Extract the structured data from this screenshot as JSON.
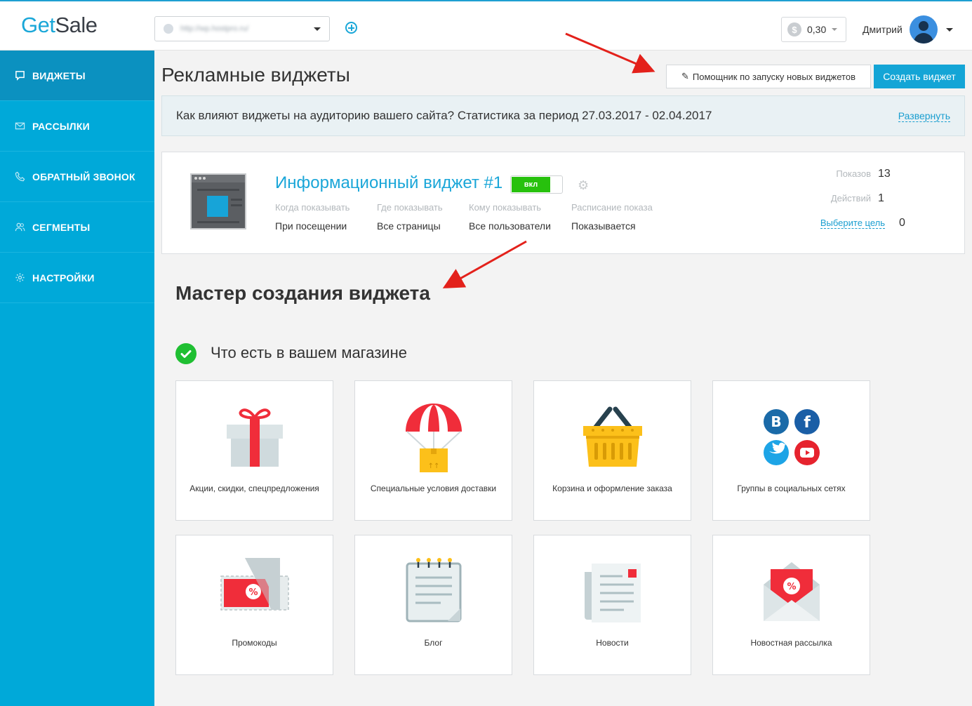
{
  "header": {
    "logo_part1": "Get",
    "logo_part2": "Sale",
    "site_url": "http://wp.hostpro.ru/",
    "balance": "0,30",
    "balance_icon": "dollar-coin-icon",
    "username": "Дмитрий"
  },
  "sidebar": {
    "items": [
      {
        "label": "ВИДЖЕТЫ",
        "icon": "chat-bubble-icon",
        "active": true
      },
      {
        "label": "РАССЫЛКИ",
        "icon": "envelope-icon",
        "active": false
      },
      {
        "label": "ОБРАТНЫЙ ЗВОНОК",
        "icon": "phone-icon",
        "active": false
      },
      {
        "label": "СЕГМЕНТЫ",
        "icon": "users-icon",
        "active": false
      },
      {
        "label": "НАСТРОЙКИ",
        "icon": "gear-icon",
        "active": false
      }
    ]
  },
  "main": {
    "title": "Рекламные виджеты",
    "helper_button": "Помощник по запуску новых виджетов",
    "create_button": "Создать виджет",
    "stats_text": "Как влияют виджеты на аудиторию вашего сайта? Статистика за период 27.03.2017 - 02.04.2017",
    "stats_expand": "Развернуть"
  },
  "widget": {
    "name": "Информационный виджет #1",
    "toggle_label": "вкл",
    "meta": [
      {
        "key": "Когда показывать",
        "value": "При посещении"
      },
      {
        "key": "Где показывать",
        "value": "Все страницы"
      },
      {
        "key": "Кому показывать",
        "value": "Все пользователи"
      },
      {
        "key": "Расписание показа",
        "value": "Показывается"
      }
    ],
    "stats": [
      {
        "key": "Показов",
        "value": "13"
      },
      {
        "key": "Действий",
        "value": "1"
      },
      {
        "key": "Выберите цель",
        "value": "0"
      }
    ]
  },
  "wizard": {
    "title": "Мастер создания виджета",
    "step_title": "Что есть в вашем магазине",
    "tiles": [
      {
        "label": "Акции, скидки, спецпредложения",
        "icon": "gift-icon"
      },
      {
        "label": "Специальные условия доставки",
        "icon": "parachute-box-icon"
      },
      {
        "label": "Корзина и оформление заказа",
        "icon": "basket-icon"
      },
      {
        "label": "Группы в социальных сетях",
        "icon": "social-networks-icon"
      },
      {
        "label": "Промокоды",
        "icon": "coupon-icon"
      },
      {
        "label": "Блог",
        "icon": "notepad-icon"
      },
      {
        "label": "Новости",
        "icon": "newspaper-icon"
      },
      {
        "label": "Новостная рассылка",
        "icon": "mail-envelope-icon"
      }
    ]
  },
  "colors": {
    "brand": "#1aa7d8",
    "sidebar": "#00a9d9",
    "sidebar_active": "#0b91c0",
    "toggle_on": "#27c10d",
    "annotation_arrow": "#e3211b"
  }
}
